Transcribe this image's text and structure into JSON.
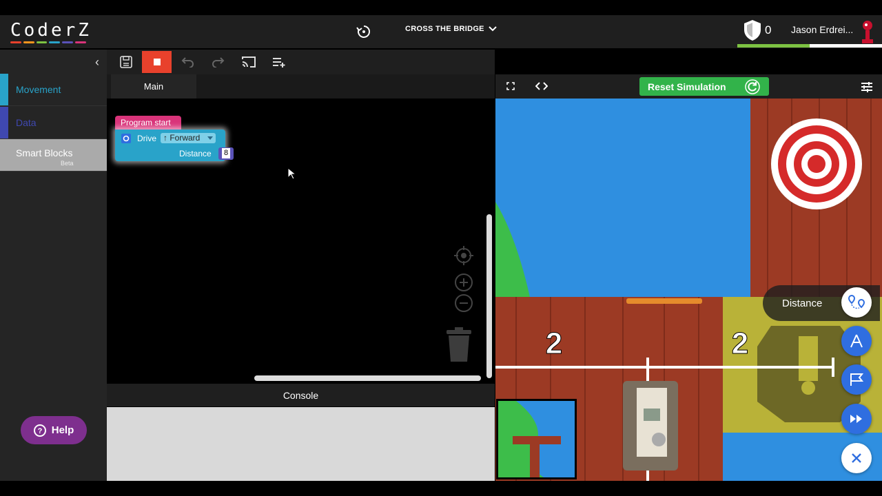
{
  "header": {
    "logo_text": "CoderZ",
    "logo_colors": [
      "#e8412c",
      "#f7941d",
      "#7dc242",
      "#29a3c9",
      "#5a52b8",
      "#d9347a"
    ],
    "mission_title": "CROSS THE BRIDGE",
    "score": "0",
    "username": "Jason Erdrei...",
    "progress_fraction": 0.5
  },
  "sidebar": {
    "categories": [
      {
        "label": "Movement",
        "color": "#29a3c9"
      },
      {
        "label": "Data",
        "color": "#3f48b0"
      },
      {
        "label": "Smart Blocks",
        "color": "#aaaaaa"
      }
    ],
    "smart_blocks_badge": "Beta",
    "help_label": "Help"
  },
  "workspace": {
    "tab_label": "Main",
    "block_program_start": "Program start",
    "block_drive": "Drive",
    "block_direction": "↑ Forward",
    "block_distance_label": "Distance",
    "block_distance_value": "8"
  },
  "console": {
    "title": "Console"
  },
  "simulation": {
    "reset_label": "Reset Simulation",
    "overlay_label": "Distance",
    "marker_left": "2",
    "marker_right": "2"
  },
  "icons": [
    "history-icon",
    "chevron-down-icon",
    "shield-icon",
    "save-icon",
    "stop-icon",
    "undo-icon",
    "redo-icon",
    "cast-icon",
    "add-playlist-icon",
    "fullscreen-icon",
    "code-icon",
    "refresh-icon",
    "sliders-icon",
    "route-icon",
    "measure-icon",
    "flag-icon",
    "fast-forward-icon",
    "close-icon",
    "crosshair-icon",
    "zoom-in-icon",
    "zoom-out-icon",
    "trash-icon",
    "help-icon"
  ]
}
